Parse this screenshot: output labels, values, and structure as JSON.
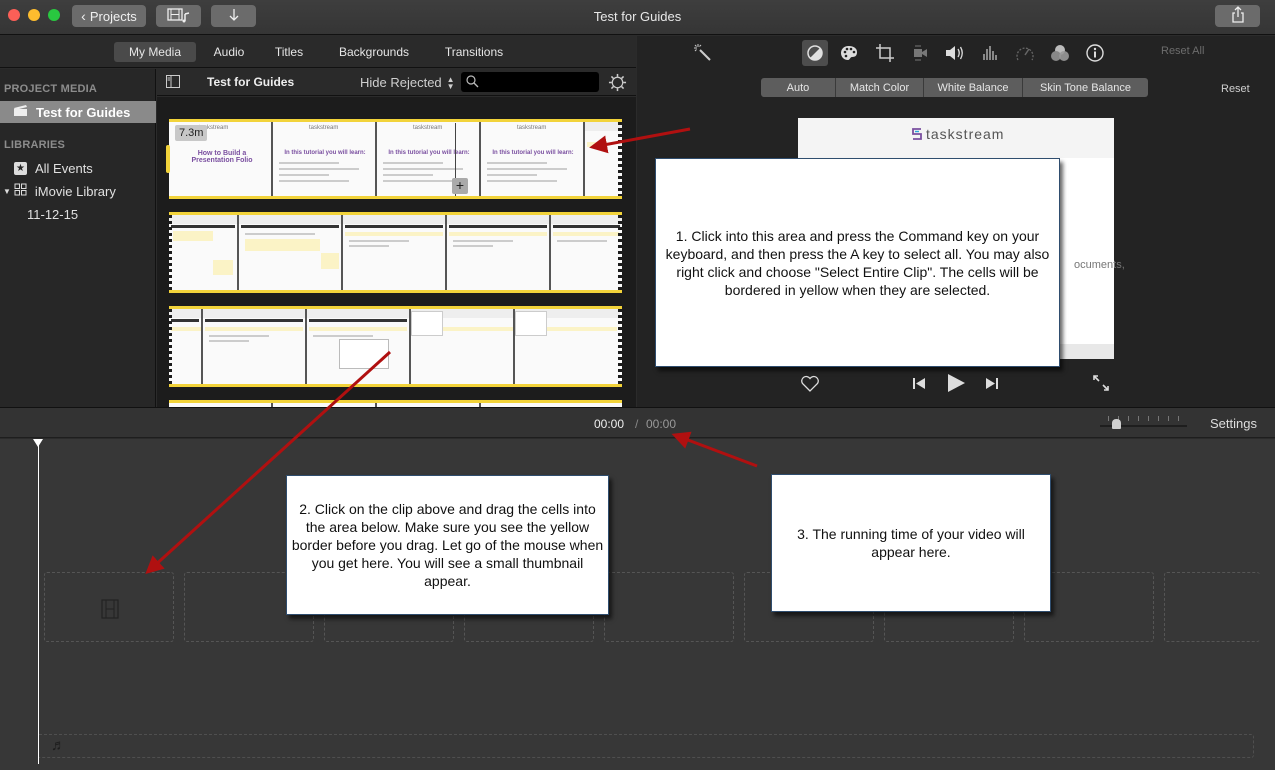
{
  "window": {
    "title": "Test for Guides",
    "projects_button": "Projects",
    "media_button_icon": "film-music-icon",
    "import_button_icon": "download-arrow-icon",
    "share_button_icon": "share-icon"
  },
  "browser_tabs": [
    {
      "label": "My Media",
      "active": true
    },
    {
      "label": "Audio",
      "active": false
    },
    {
      "label": "Titles",
      "active": false
    },
    {
      "label": "Backgrounds",
      "active": false
    },
    {
      "label": "Transitions",
      "active": false
    }
  ],
  "sidebar": {
    "project_media_header": "PROJECT MEDIA",
    "project_item": "Test for Guides",
    "libraries_header": "LIBRARIES",
    "all_events": "All Events",
    "library": "iMovie Library",
    "event": "11-12-15"
  },
  "browser_toolbar": {
    "title": "Test for Guides",
    "filter": "Hide Rejected",
    "search_placeholder": ""
  },
  "clips": {
    "first_clip_duration": "7.3m",
    "first_frames": [
      {
        "brand": "taskstream",
        "title": "How to Build a Presentation Folio"
      },
      {
        "brand": "taskstream",
        "title": "In this tutorial you will learn:"
      },
      {
        "brand": "taskstream",
        "title": "In this tutorial you will learn:"
      },
      {
        "brand": "taskstream",
        "title": "In this tutorial you will learn:"
      }
    ]
  },
  "viewer": {
    "toolbar_icons": [
      "magic-wand-icon",
      "color-balance-icon",
      "color-correction-icon",
      "crop-icon",
      "stabilization-icon",
      "volume-icon",
      "equalizer-icon",
      "speed-icon",
      "clip-filter-icon",
      "info-icon"
    ],
    "reset_all": "Reset All",
    "segments": [
      "Auto",
      "Match Color",
      "White Balance",
      "Skin Tone Balance"
    ],
    "reset": "Reset",
    "preview_brand": "taskstream",
    "preview_partial_text": "ocuments,"
  },
  "timeline": {
    "current_time": "00:00",
    "separator": "/",
    "total_time": "00:00",
    "settings": "Settings",
    "zoom_level": 0.15
  },
  "callouts": {
    "one": "1. Click into this area and press the Command key on your keyboard, and then press the A key to select all.  You may also right click and choose \"Select Entire Clip\".  The cells will be bordered in yellow when they are selected.",
    "two": "2. Click on the clip above and drag the cells into the area below.  Make sure you see the yellow border before you drag.  Let go of the mouse when you get here.  You will see a small thumbnail appear.",
    "three": "3. The running time of your video will appear here."
  },
  "colors": {
    "selection_yellow": "#f2d33a",
    "arrow_red": "#b01010",
    "brand_purple": "#7a4fa0"
  }
}
